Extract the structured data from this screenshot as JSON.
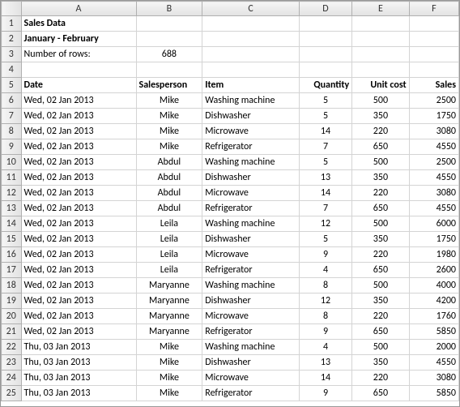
{
  "columns": [
    "A",
    "B",
    "C",
    "D",
    "E",
    "F"
  ],
  "header": {
    "title": "Sales Data",
    "subtitle": "January - February",
    "num_rows_label": "Number of rows:",
    "num_rows_value": "688"
  },
  "table_headers": {
    "date": "Date",
    "salesperson": "Salesperson",
    "item": "Item",
    "quantity": "Quantity",
    "unit_cost": "Unit cost",
    "sales": "Sales"
  },
  "rows": [
    {
      "n": 6,
      "date": "Wed, 02 Jan 2013",
      "sp": "Mike",
      "item": "Washing machine",
      "qty": "5",
      "cost": "500",
      "sales": "2500"
    },
    {
      "n": 7,
      "date": "Wed, 02 Jan 2013",
      "sp": "Mike",
      "item": "Dishwasher",
      "qty": "5",
      "cost": "350",
      "sales": "1750"
    },
    {
      "n": 8,
      "date": "Wed, 02 Jan 2013",
      "sp": "Mike",
      "item": "Microwave",
      "qty": "14",
      "cost": "220",
      "sales": "3080"
    },
    {
      "n": 9,
      "date": "Wed, 02 Jan 2013",
      "sp": "Mike",
      "item": "Refrigerator",
      "qty": "7",
      "cost": "650",
      "sales": "4550"
    },
    {
      "n": 10,
      "date": "Wed, 02 Jan 2013",
      "sp": "Abdul",
      "item": "Washing machine",
      "qty": "5",
      "cost": "500",
      "sales": "2500"
    },
    {
      "n": 11,
      "date": "Wed, 02 Jan 2013",
      "sp": "Abdul",
      "item": "Dishwasher",
      "qty": "13",
      "cost": "350",
      "sales": "4550"
    },
    {
      "n": 12,
      "date": "Wed, 02 Jan 2013",
      "sp": "Abdul",
      "item": "Microwave",
      "qty": "14",
      "cost": "220",
      "sales": "3080"
    },
    {
      "n": 13,
      "date": "Wed, 02 Jan 2013",
      "sp": "Abdul",
      "item": "Refrigerator",
      "qty": "7",
      "cost": "650",
      "sales": "4550"
    },
    {
      "n": 14,
      "date": "Wed, 02 Jan 2013",
      "sp": "Leila",
      "item": "Washing machine",
      "qty": "12",
      "cost": "500",
      "sales": "6000"
    },
    {
      "n": 15,
      "date": "Wed, 02 Jan 2013",
      "sp": "Leila",
      "item": "Dishwasher",
      "qty": "5",
      "cost": "350",
      "sales": "1750"
    },
    {
      "n": 16,
      "date": "Wed, 02 Jan 2013",
      "sp": "Leila",
      "item": "Microwave",
      "qty": "9",
      "cost": "220",
      "sales": "1980"
    },
    {
      "n": 17,
      "date": "Wed, 02 Jan 2013",
      "sp": "Leila",
      "item": "Refrigerator",
      "qty": "4",
      "cost": "650",
      "sales": "2600"
    },
    {
      "n": 18,
      "date": "Wed, 02 Jan 2013",
      "sp": "Maryanne",
      "item": "Washing machine",
      "qty": "8",
      "cost": "500",
      "sales": "4000"
    },
    {
      "n": 19,
      "date": "Wed, 02 Jan 2013",
      "sp": "Maryanne",
      "item": "Dishwasher",
      "qty": "12",
      "cost": "350",
      "sales": "4200"
    },
    {
      "n": 20,
      "date": "Wed, 02 Jan 2013",
      "sp": "Maryanne",
      "item": "Microwave",
      "qty": "8",
      "cost": "220",
      "sales": "1760"
    },
    {
      "n": 21,
      "date": "Wed, 02 Jan 2013",
      "sp": "Maryanne",
      "item": "Refrigerator",
      "qty": "9",
      "cost": "650",
      "sales": "5850"
    },
    {
      "n": 22,
      "date": "Thu, 03 Jan 2013",
      "sp": "Mike",
      "item": "Washing machine",
      "qty": "4",
      "cost": "500",
      "sales": "2000"
    },
    {
      "n": 23,
      "date": "Thu, 03 Jan 2013",
      "sp": "Mike",
      "item": "Dishwasher",
      "qty": "13",
      "cost": "350",
      "sales": "4550"
    },
    {
      "n": 24,
      "date": "Thu, 03 Jan 2013",
      "sp": "Mike",
      "item": "Microwave",
      "qty": "14",
      "cost": "220",
      "sales": "3080"
    },
    {
      "n": 25,
      "date": "Thu, 03 Jan 2013",
      "sp": "Mike",
      "item": "Refrigerator",
      "qty": "9",
      "cost": "650",
      "sales": "5850"
    }
  ]
}
